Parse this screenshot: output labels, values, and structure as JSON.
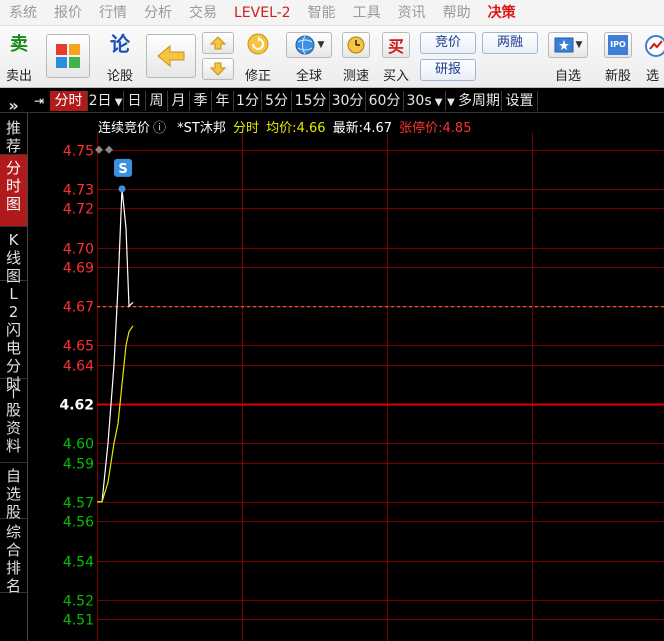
{
  "menu": {
    "items": [
      {
        "label": "系统",
        "style": "normal"
      },
      {
        "label": "报价",
        "style": "normal"
      },
      {
        "label": "行情",
        "style": "normal"
      },
      {
        "label": "分析",
        "style": "normal"
      },
      {
        "label": "交易",
        "style": "normal"
      },
      {
        "label": "LEVEL-2",
        "style": "red"
      },
      {
        "label": "智能",
        "style": "normal"
      },
      {
        "label": "工具",
        "style": "normal"
      },
      {
        "label": "资讯",
        "style": "normal"
      },
      {
        "label": "帮助",
        "style": "normal"
      },
      {
        "label": "决策",
        "style": "bold"
      }
    ]
  },
  "toolbar": {
    "sell_glyph": "卖",
    "sell_label": "卖出",
    "stock_glyph": "论",
    "stock_label": "论股",
    "correct_label": "修正",
    "global_label": "全球",
    "speed_label": "测速",
    "buy_glyph": "买",
    "buy_label": "买入",
    "bid_label": "竞价",
    "margin_label": "两融",
    "research_label": "研报",
    "watch_label": "自选",
    "ipo_glyph": "IPO",
    "ipo_label": "新股",
    "pick_label": "选"
  },
  "tabs": {
    "items": [
      "分时",
      "2日",
      "日",
      "周",
      "月",
      "季",
      "年",
      "1分",
      "5分",
      "15分",
      "30分",
      "60分",
      "30s",
      "多周期",
      "设置"
    ],
    "active": "分时"
  },
  "leftnav": {
    "items": [
      {
        "label": "推荐",
        "active": false
      },
      {
        "label": "分时图",
        "active": true
      },
      {
        "label": "K线图",
        "active": false
      },
      {
        "label": "L2闪电分时",
        "active": false
      },
      {
        "label": "个股资料",
        "active": false
      },
      {
        "label": "自选股",
        "active": false
      },
      {
        "label": "综合排名",
        "active": false
      }
    ],
    "expand_glyph": "»"
  },
  "chart_header": {
    "auction_label": "连续竞价",
    "stock_name": "*ST沐邦",
    "mode": "分时",
    "avg_label": "均价:",
    "avg_value": "4.66",
    "latest_label": "最新:",
    "latest_value": "4.67",
    "limit_label": "张停价:",
    "limit_value": "4.85",
    "marker": "S"
  },
  "colors": {
    "up": "#ff3030",
    "down": "#00c000",
    "flat": "#ffffff",
    "grid": "#7a0000",
    "price_line": "#ffffff",
    "avg_line": "#e8e800",
    "active_tab": "#b01a1a"
  },
  "chart_data": {
    "type": "line",
    "title": "",
    "y_ticks": [
      4.75,
      4.73,
      4.72,
      4.7,
      4.69,
      4.67,
      4.65,
      4.64,
      4.62,
      4.6,
      4.59,
      4.57,
      4.56,
      4.54,
      4.52,
      4.51
    ],
    "prev_close": 4.62,
    "ylim": [
      4.505,
      4.755
    ],
    "series": [
      {
        "values": [
          4.57,
          4.57,
          4.6,
          4.64,
          4.68,
          4.73,
          4.71,
          4.67,
          4.672
        ]
      },
      {
        "values": [
          4.57,
          4.57,
          4.58,
          4.6,
          4.61,
          4.63,
          4.65,
          4.657,
          4.66
        ]
      }
    ]
  }
}
